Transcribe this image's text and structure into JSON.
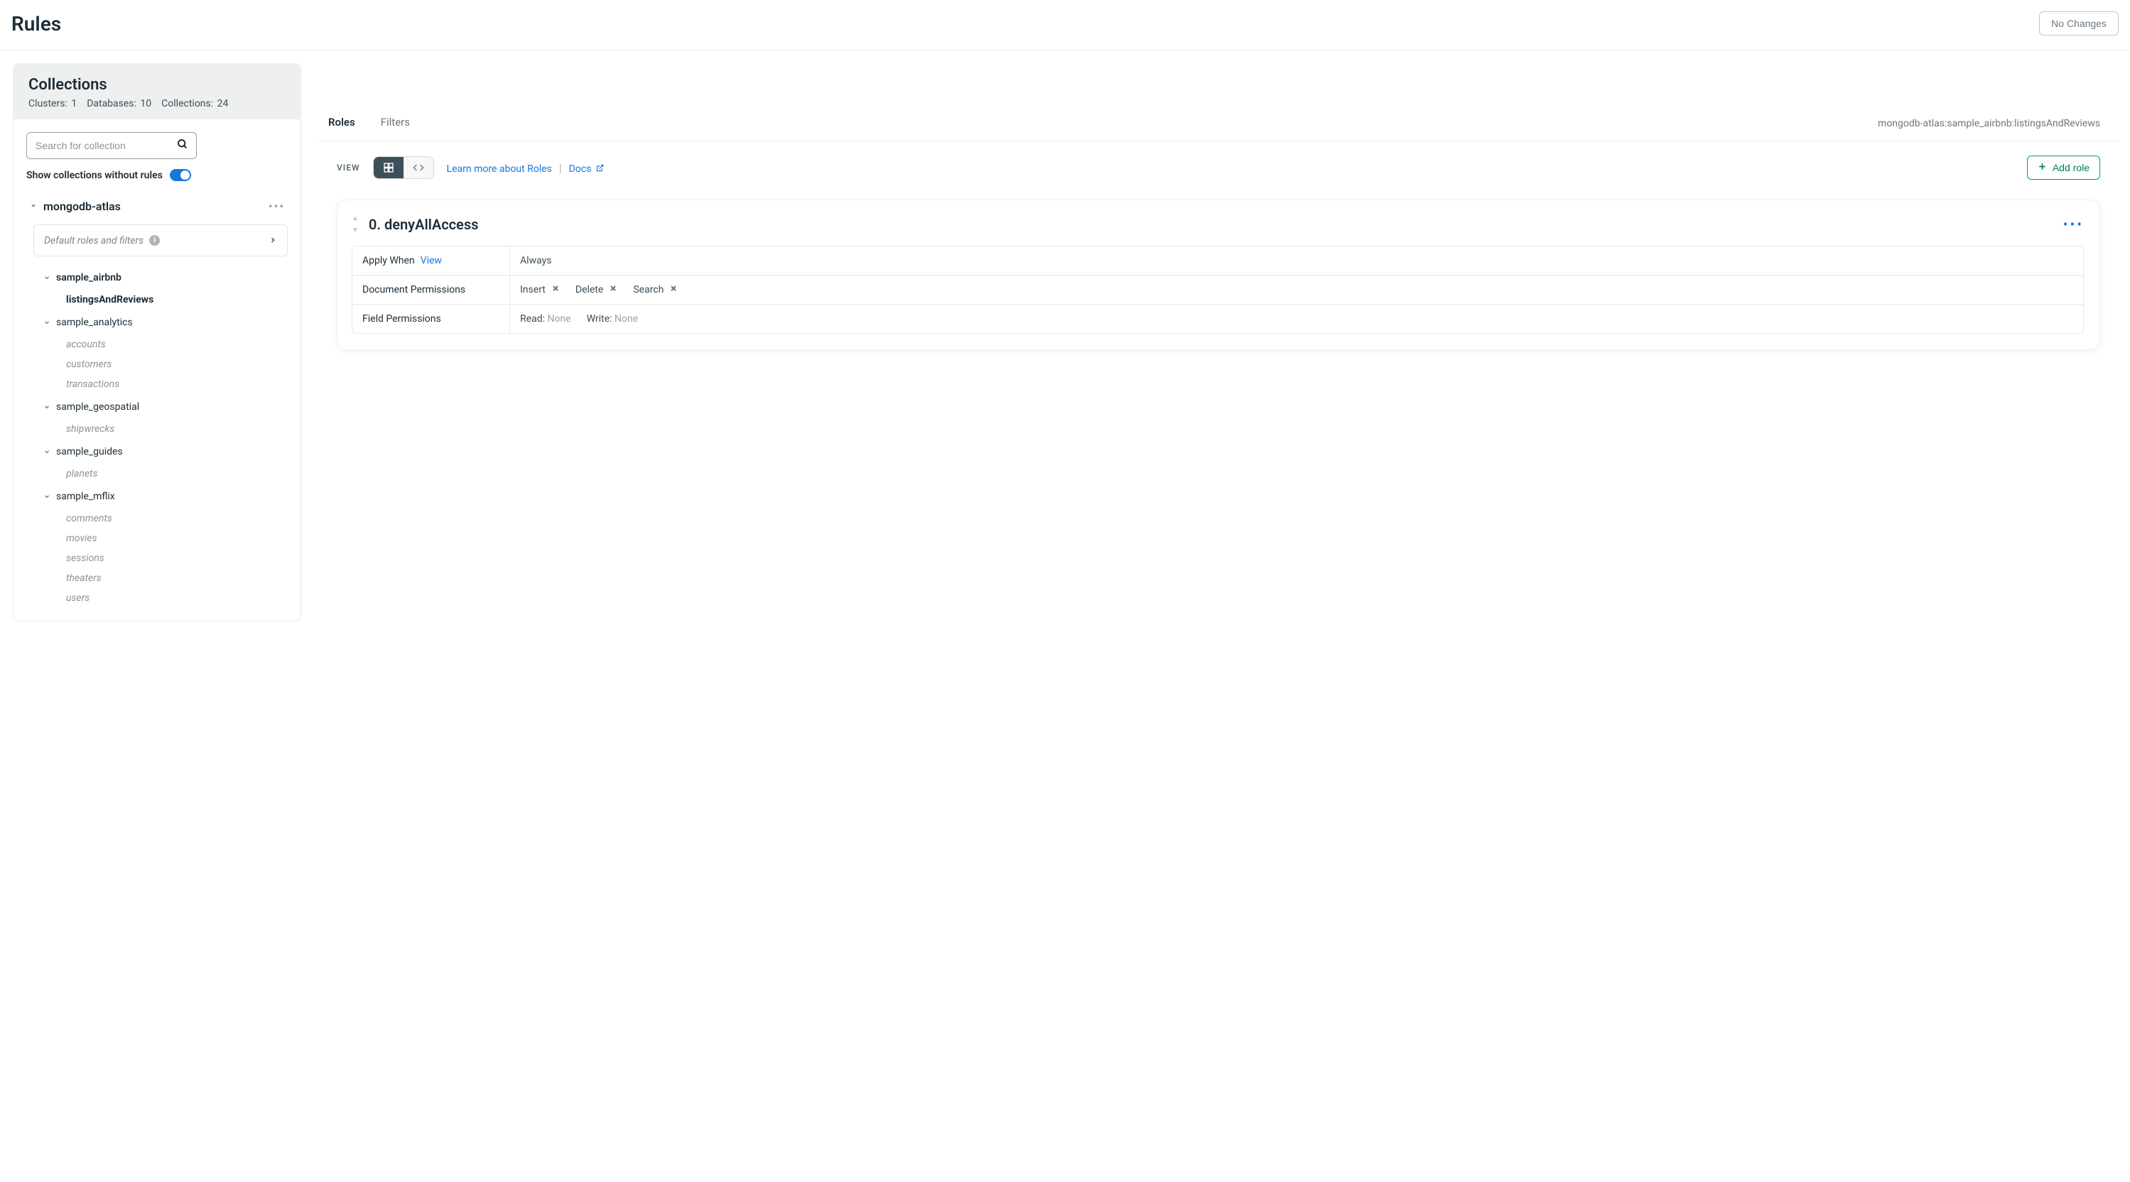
{
  "page_title": "Rules",
  "no_changes_label": "No Changes",
  "sidebar": {
    "title": "Collections",
    "stats": {
      "clusters_label": "Clusters:",
      "clusters_value": "1",
      "databases_label": "Databases:",
      "databases_value": "10",
      "collections_label": "Collections:",
      "collections_value": "24"
    },
    "search_placeholder": "Search for collection",
    "toggle_label": "Show collections without rules",
    "cluster_name": "mongodb-atlas",
    "default_roles_label": "Default roles and filters",
    "databases": [
      {
        "name": "sample_airbnb",
        "collections": [
          "listingsAndReviews"
        ]
      },
      {
        "name": "sample_analytics",
        "collections": [
          "accounts",
          "customers",
          "transactions"
        ]
      },
      {
        "name": "sample_geospatial",
        "collections": [
          "shipwrecks"
        ]
      },
      {
        "name": "sample_guides",
        "collections": [
          "planets"
        ]
      },
      {
        "name": "sample_mflix",
        "collections": [
          "comments",
          "movies",
          "sessions",
          "theaters",
          "users"
        ]
      }
    ]
  },
  "main": {
    "tabs": {
      "roles": "Roles",
      "filters": "Filters"
    },
    "breadcrumb": "mongodb-atlas:sample_airbnb:listingsAndReviews",
    "view_label": "VIEW",
    "learn_link": "Learn more about Roles",
    "docs_link": "Docs",
    "add_role_label": "Add role",
    "role": {
      "title": "0. denyAllAccess",
      "apply_when_label": "Apply When",
      "apply_when_view": "View",
      "apply_when_value": "Always",
      "doc_perm_label": "Document Permissions",
      "doc_perms": {
        "insert": "Insert",
        "delete": "Delete",
        "search": "Search"
      },
      "field_perm_label": "Field Permissions",
      "read_label": "Read:",
      "read_value": "None",
      "write_label": "Write:",
      "write_value": "None"
    }
  }
}
